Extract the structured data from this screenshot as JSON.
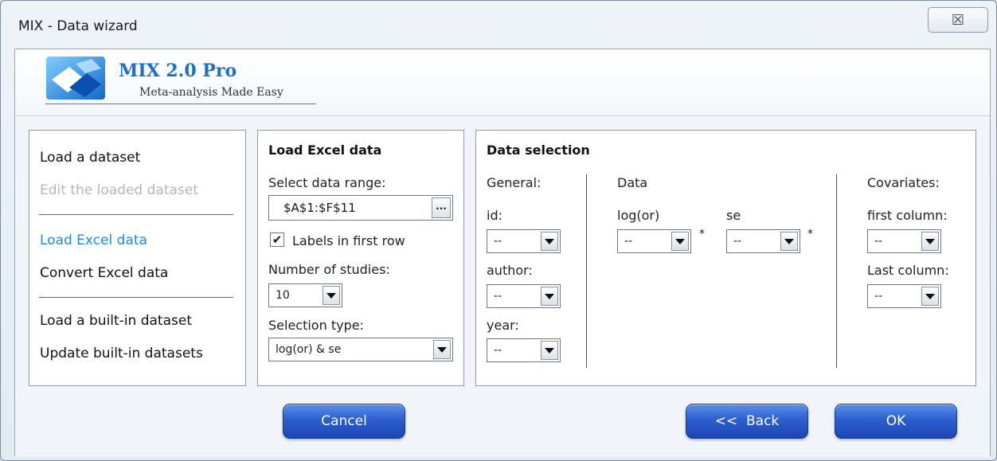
{
  "window": {
    "title": "MIX - Data wizard",
    "close_glyph": "☒"
  },
  "header": {
    "logo_title": "MIX 2.0 Pro",
    "logo_subtitle": "Meta-analysis Made Easy"
  },
  "nav": {
    "items": [
      {
        "label": "Load a dataset",
        "state": "normal"
      },
      {
        "label": "Edit the loaded dataset",
        "state": "disabled"
      },
      {
        "label": "Load Excel data",
        "state": "active"
      },
      {
        "label": "Convert Excel data",
        "state": "normal"
      },
      {
        "label": "Load a built-in dataset",
        "state": "normal"
      },
      {
        "label": "Update built-in datasets",
        "state": "normal"
      }
    ]
  },
  "excel": {
    "title": "Load Excel data",
    "range_label": "Select data range:",
    "range_value": "$A$1:$F$11",
    "range_button": "...",
    "labels_checkbox": "Labels in first row",
    "labels_checked_glyph": "✔",
    "studies_label": "Number of studies:",
    "studies_value": "10",
    "selection_label": "Selection type:",
    "selection_value": "log(or) & se"
  },
  "selection": {
    "title": "Data selection",
    "general_label": "General:",
    "id_label": "id:",
    "id_value": "--",
    "author_label": "author:",
    "author_value": "--",
    "year_label": "year:",
    "year_value": "--",
    "data_label": "Data",
    "logor_label": "log(or)",
    "logor_value": "--",
    "se_label": "se",
    "se_value": "--",
    "required_mark": "*",
    "covariates_label": "Covariates:",
    "first_col_label": "first column:",
    "first_col_value": "--",
    "last_col_label": "Last column:",
    "last_col_value": "--"
  },
  "buttons": {
    "cancel": "Cancel",
    "back": "<<  Back",
    "ok": "OK"
  },
  "colors": {
    "accent": "#1e8be0",
    "button": "#2d5fcf",
    "disabled": "#b2b7bc"
  }
}
